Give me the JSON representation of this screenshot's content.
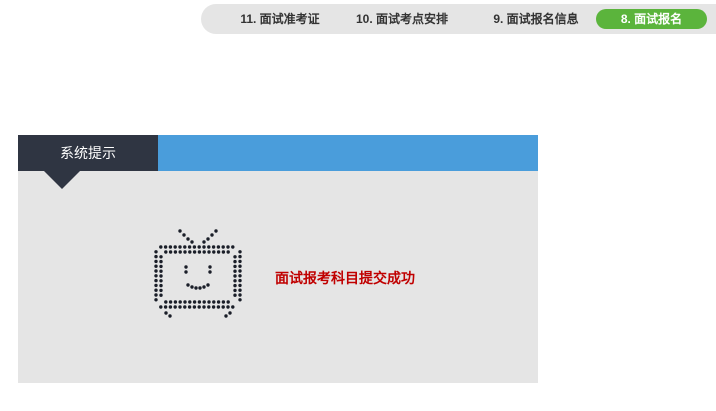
{
  "steps": [
    {
      "label": "11. 面试准考证",
      "active": false
    },
    {
      "label": "10. 面试考点安排",
      "active": false
    },
    {
      "label": "9. 面试报名信息",
      "active": false
    },
    {
      "label": "8. 面试报名",
      "active": true
    }
  ],
  "colors": {
    "active_step": "#5bb43c",
    "panel_header": "#4a9ddb",
    "title_tab": "#2f3542",
    "panel_body": "#e5e5e5",
    "message_text": "#c00000"
  },
  "panel": {
    "title": "系统提示",
    "icon": "tv-icon",
    "message": "面试报考科目提交成功"
  }
}
